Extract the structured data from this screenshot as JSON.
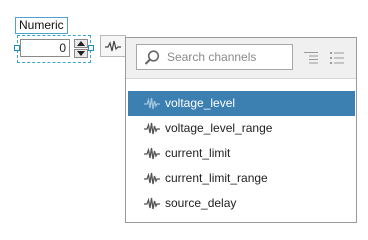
{
  "control": {
    "label": "Numeric",
    "value": "0"
  },
  "channel_picker": {
    "search_placeholder": "Search channels",
    "items": [
      {
        "label": "voltage_level",
        "selected": true
      },
      {
        "label": "voltage_level_range",
        "selected": false
      },
      {
        "label": "current_limit",
        "selected": false
      },
      {
        "label": "current_limit_range",
        "selected": false
      },
      {
        "label": "source_delay",
        "selected": false
      }
    ]
  },
  "colors": {
    "selection": "#3c7fb1",
    "selection_handle": "#1a8fc4"
  },
  "icons": {
    "toggle": "waveform-icon",
    "search": "search-icon",
    "view_a": "list-view-icon",
    "view_b": "tree-view-icon",
    "item": "waveform-icon"
  }
}
